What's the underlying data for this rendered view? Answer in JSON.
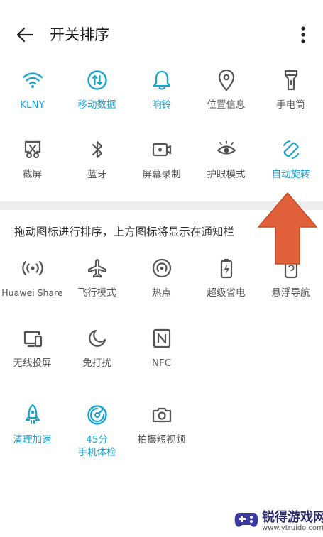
{
  "header": {
    "title": "开关排序"
  },
  "colors": {
    "accent": "#1aa3cf",
    "inactive": "#555555",
    "arrow": "#e0603a"
  },
  "active_tiles": [
    {
      "label": "KLNY",
      "icon": "wifi-icon"
    },
    {
      "label": "移动数据",
      "icon": "mobile-data-icon"
    },
    {
      "label": "响铃",
      "icon": "bell-icon"
    },
    {
      "label": "位置信息",
      "icon": "location-icon"
    },
    {
      "label": "手电筒",
      "icon": "flashlight-icon"
    },
    {
      "label": "截屏",
      "icon": "screenshot-icon"
    },
    {
      "label": "蓝牙",
      "icon": "bluetooth-icon"
    },
    {
      "label": "屏幕录制",
      "icon": "screen-record-icon"
    },
    {
      "label": "护眼模式",
      "icon": "eye-comfort-icon"
    },
    {
      "label": "自动旋转",
      "icon": "auto-rotate-icon"
    }
  ],
  "hint": "拖动图标进行排序，上方图标将显示在通知栏",
  "more_tiles": [
    {
      "label": "Huawei Share",
      "icon": "huawei-share-icon"
    },
    {
      "label": "飞行模式",
      "icon": "airplane-icon"
    },
    {
      "label": "热点",
      "icon": "hotspot-icon"
    },
    {
      "label": "超级省电",
      "icon": "battery-saver-icon"
    },
    {
      "label": "悬浮导航",
      "icon": "floating-nav-icon"
    },
    {
      "label": "无线投屏",
      "icon": "wireless-projection-icon"
    },
    {
      "label": "免打扰",
      "icon": "do-not-disturb-icon"
    },
    {
      "label": "NFC",
      "icon": "nfc-icon"
    },
    {
      "label": "清理加速",
      "icon": "rocket-icon"
    },
    {
      "label_line1": "45分",
      "label_line2": "手机体检",
      "icon": "phone-checkup-icon"
    },
    {
      "label": "拍摄短视频",
      "icon": "camera-icon"
    }
  ],
  "watermark": {
    "title": "锐得游戏网",
    "url": "www.ytruido.com"
  }
}
